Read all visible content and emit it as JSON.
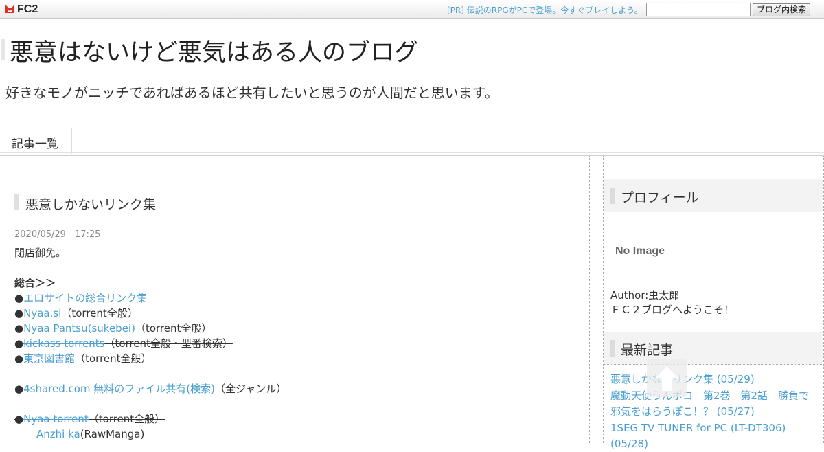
{
  "topbar": {
    "logo_text": "FC2",
    "pr_link": "[PR] 伝説のRPGがPCで登場。今すぐプレイしよう。",
    "search_placeholder": "",
    "search_button": "ブログ内検索"
  },
  "header": {
    "title": "悪意はないけど悪気はある人のブログ",
    "description": "好きなモノがニッチであればあるほど共有したいと思うのが人間だと思います。"
  },
  "nav": {
    "items": [
      "記事一覧"
    ]
  },
  "entry": {
    "title": "悪意しかないリンク集",
    "date": "2020/05/29　17:25",
    "intro": "閉店御免。",
    "section_heading": "総合＞＞",
    "bullet": "●",
    "links": [
      {
        "text": "エロサイトの総合リンク集",
        "note": "",
        "struck": false
      },
      {
        "text": "Nyaa.si",
        "note": "（torrent全般）",
        "struck": false
      },
      {
        "text": "Nyaa Pantsu(sukebei)",
        "note": "（torrent全般）",
        "struck": false
      },
      {
        "text": "kickass torrents",
        "note": "（torrent全般・型番検索）",
        "struck": true
      },
      {
        "text": "東京図書館",
        "note": "（torrent全般）",
        "struck": false
      }
    ],
    "links2": [
      {
        "text": "4shared.com 無料のファイル共有(検索)",
        "note": "（全ジャンル）",
        "struck": false
      }
    ],
    "links3": [
      {
        "text": "Nyaa torrent",
        "note": "（torrent全般）",
        "struck": true
      },
      {
        "text": "Anzhi ka",
        "note": "(RawManga)",
        "struck": false
      }
    ]
  },
  "sidebar": {
    "profile_heading": "プロフィール",
    "no_image": "No Image",
    "author": "Author:虫太郎",
    "welcome": "ＦＣ２ブログへようこそ！",
    "recent_heading": "最新記事",
    "recent": [
      "悪意しかないリンク集 (05/29)",
      "魔動天使うんポコ　第2巻　第2話　勝負で邪気をはらうぽこ！？ (05/27)",
      "1SEG TV TUNER for PC (LT-DT306) (05/28)"
    ]
  },
  "colors": {
    "link": "#4a9fd0",
    "text": "#333333",
    "muted": "#888888"
  }
}
